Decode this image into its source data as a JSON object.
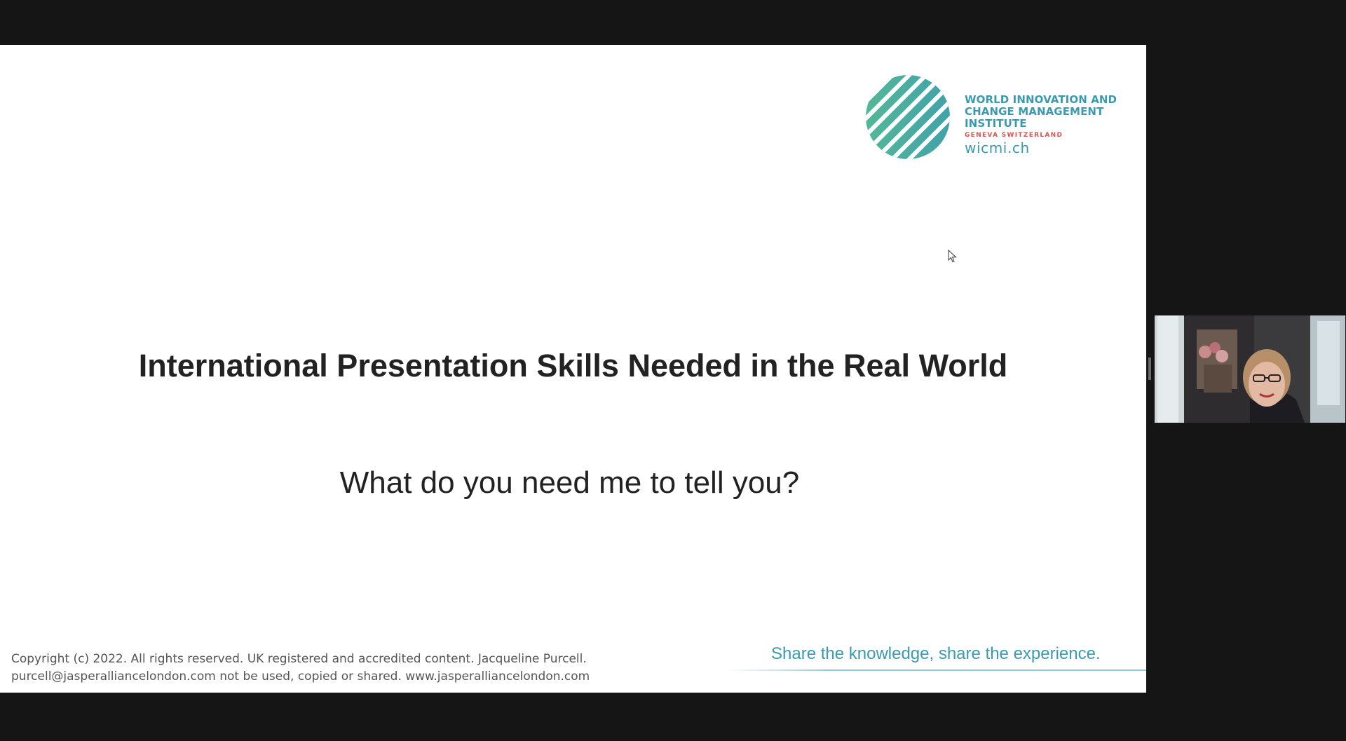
{
  "slide": {
    "logo": {
      "line1": "WORLD INNOVATION AND",
      "line2": "CHANGE MANAGEMENT",
      "line3": "INSTITUTE",
      "location": "GENEVA SWITZERLAND",
      "site": "wicmi.ch"
    },
    "title": "International Presentation Skills Needed in the Real World",
    "subtitle": "What do you need me to tell you?",
    "footer": {
      "copyright_line1": "Copyright (c) 2022. All rights reserved. UK registered and accredited content. Jacqueline Purcell.",
      "copyright_line2": "purcell@jasperalliancelondon.com not be used, copied or shared. www.jasperalliancelondon.com",
      "tagline": "Share the knowledge, share the experience."
    }
  },
  "colors": {
    "background": "#151515",
    "slide": "#ffffff",
    "brand_teal": "#3a9ab0",
    "brand_green": "#5bbf91",
    "brand_red": "#d9534f"
  },
  "icons": {
    "logo": "striped-circle-logo",
    "cursor": "mouse-pointer-icon"
  }
}
